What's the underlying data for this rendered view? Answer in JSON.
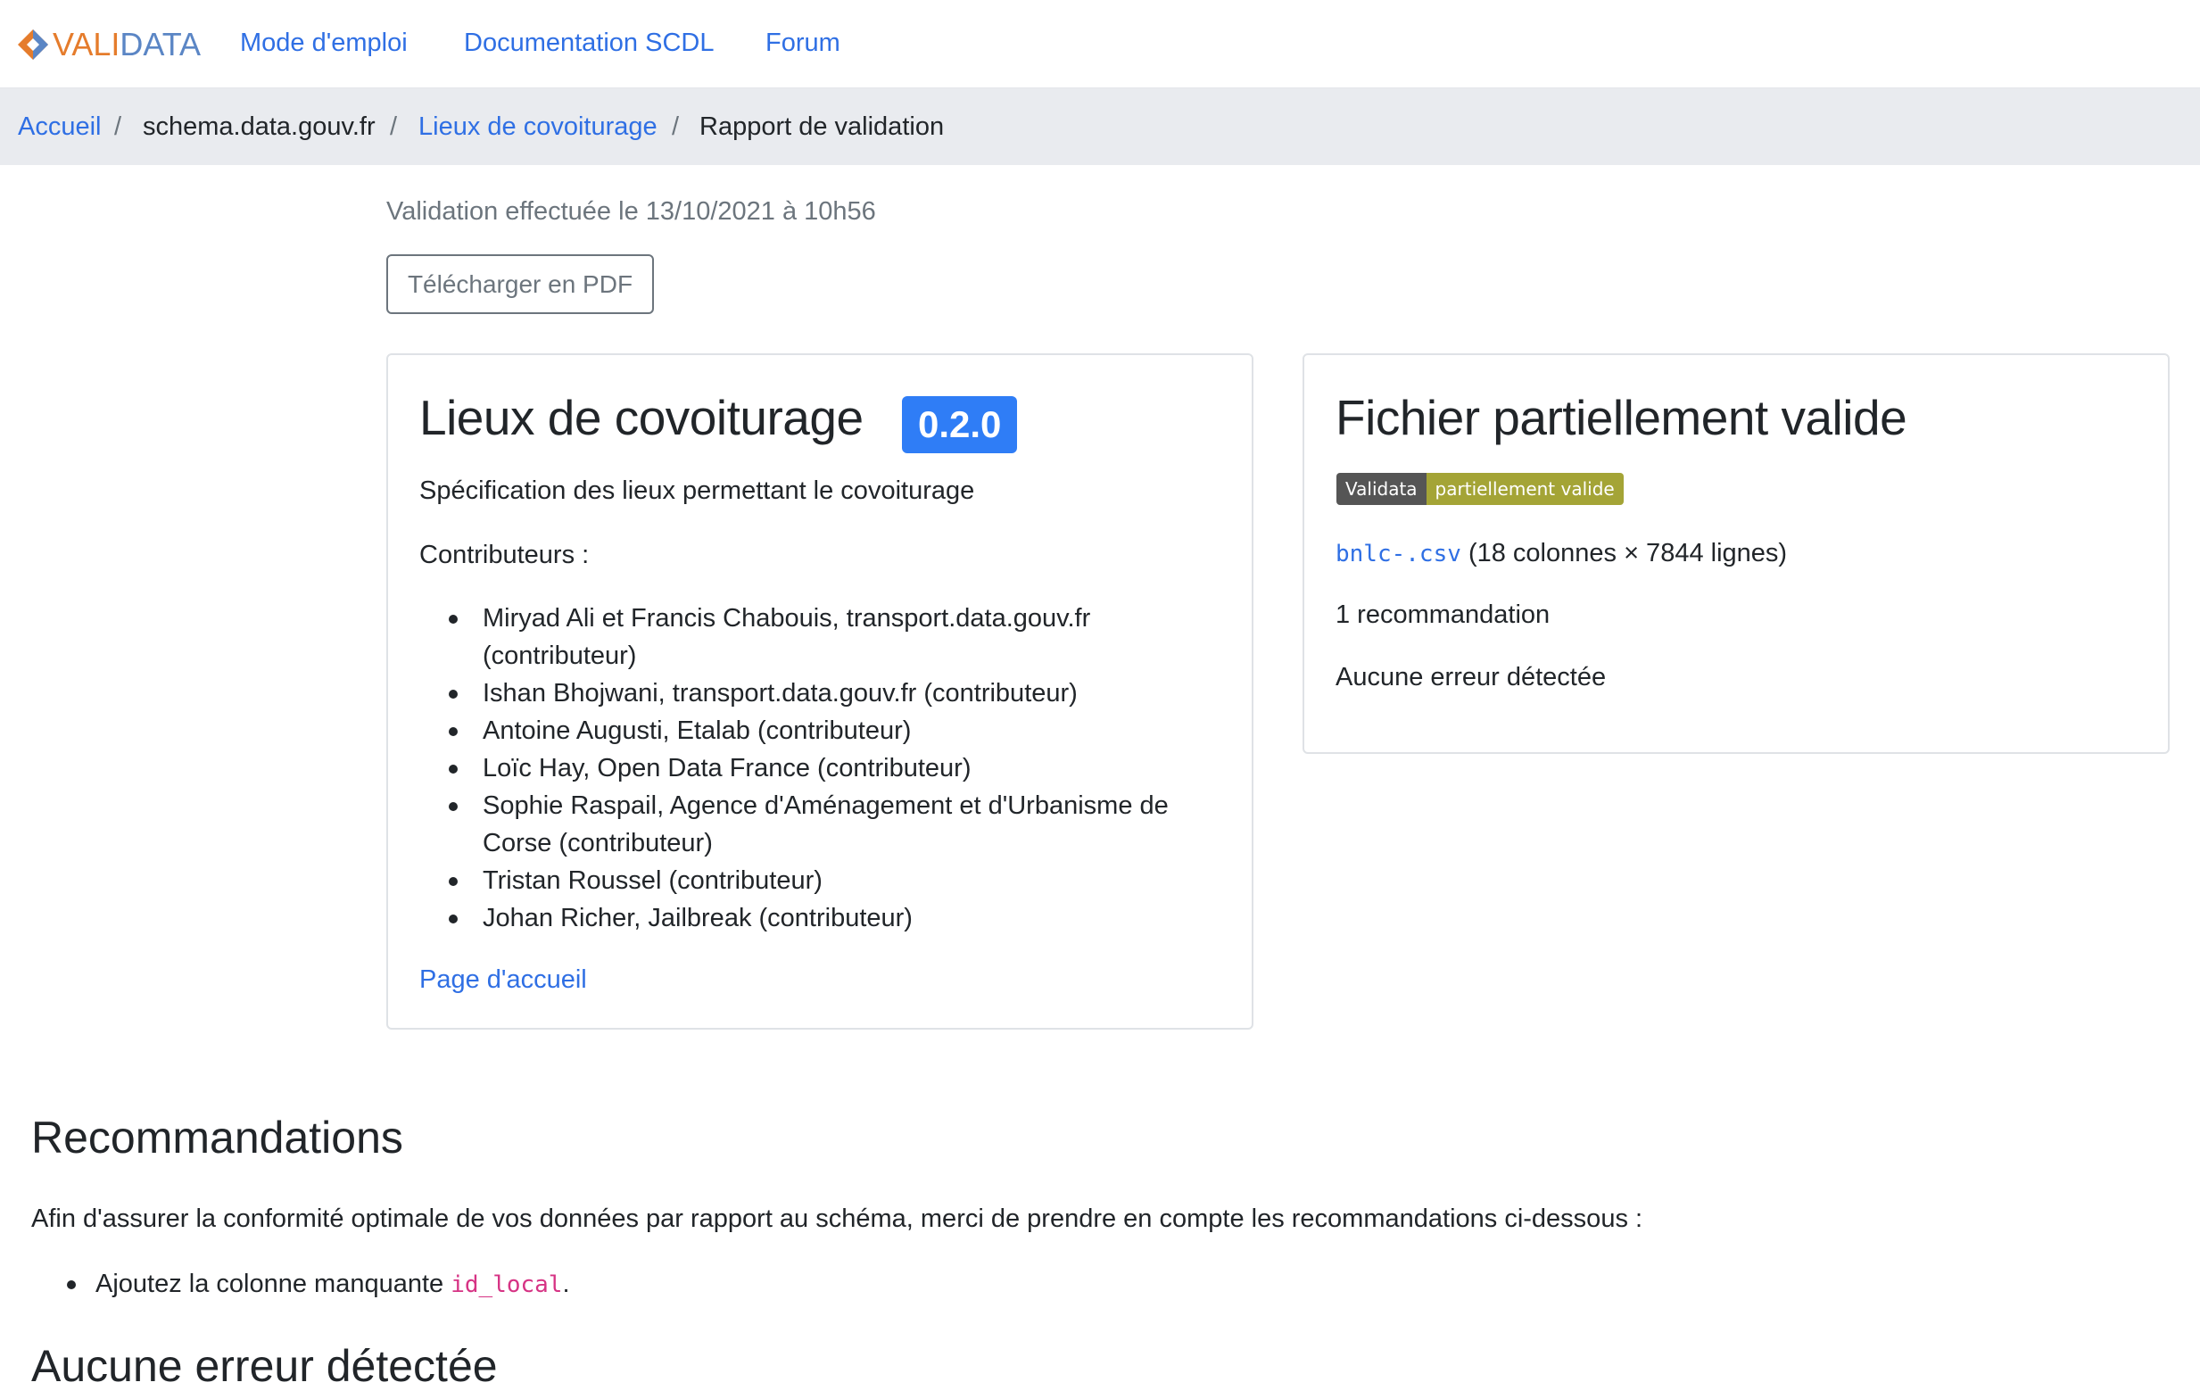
{
  "navbar": {
    "brand_a": "VALI",
    "brand_b": "DATA",
    "links": [
      "Mode d'emploi",
      "Documentation SCDL",
      "Forum"
    ]
  },
  "breadcrumb": {
    "items": [
      "Accueil",
      "schema.data.gouv.fr",
      "Lieux de covoiturage",
      "Rapport de validation"
    ],
    "separator": "/"
  },
  "report": {
    "date_text": "Validation effectuée le 13/10/2021 à 10h56",
    "pdf_button": "Télécharger en PDF"
  },
  "schema_card": {
    "title": "Lieux de covoiturage",
    "version": "0.2.0",
    "description": "Spécification des lieux permettant le covoiturage",
    "contributors_label": "Contributeurs :",
    "contributors": [
      "Miryad Ali et Francis Chabouis, transport.data.gouv.fr (contributeur)",
      "Ishan Bhojwani, transport.data.gouv.fr (contributeur)",
      "Antoine Augusti, Etalab (contributeur)",
      "Loïc Hay, Open Data France (contributeur)",
      "Sophie Raspail, Agence d'Aménagement et d'Urbanisme de Corse (contributeur)",
      "Tristan Roussel (contributeur)",
      "Johan Richer, Jailbreak (contributeur)"
    ],
    "homepage_link": "Page d'accueil"
  },
  "result_card": {
    "title": "Fichier partiellement valide",
    "badge_left": "Validata",
    "badge_right": "partiellement valide",
    "file_name": "bnlc-.csv",
    "file_info": "(18 colonnes × 7844 lignes)",
    "recommendations_count": "1 recommandation",
    "errors_text": "Aucune erreur détectée"
  },
  "recommendations": {
    "title": "Recommandations",
    "intro": "Afin d'assurer la conformité optimale de vos données par rapport au schéma, merci de prendre en compte les recommandations ci-dessous :",
    "items": [
      {
        "prefix": "Ajoutez la colonne manquante ",
        "code": "id_local",
        "suffix": "."
      }
    ]
  },
  "next_section_title": "Aucune erreur détectée",
  "colors": {
    "link": "#2f6fe4",
    "version_badge": "#2f7df6",
    "status_badge": "#a4a436",
    "code_pink": "#d63384"
  }
}
